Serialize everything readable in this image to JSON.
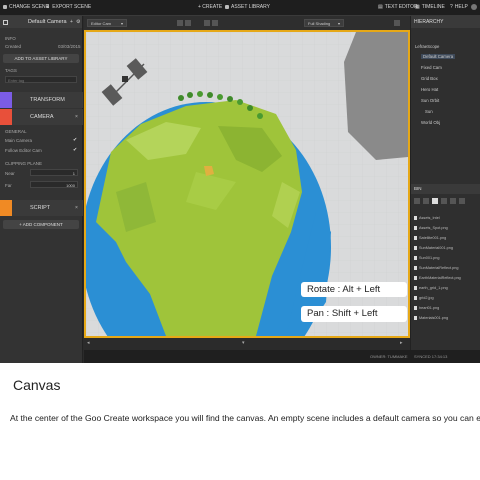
{
  "topbar": {
    "change_scene": "CHANGE SCENE",
    "export_scene": "EXPORT SCENE",
    "create": "+ CREATE",
    "asset_library": "ASSET LIBRARY",
    "text_editor": "TEXT EDITOR",
    "timeline": "TIMELINE",
    "help": "HELP"
  },
  "left_panel": {
    "title": "Default Camera",
    "info_label": "INFO",
    "created_label": "Created",
    "created_date": "03/03/2015",
    "add_to_library": "ADD TO ASSET LIBRARY",
    "tags_label": "TAGS",
    "tags_placeholder": "Enter tag",
    "transform_label": "TRANSFORM",
    "camera_label": "CAMERA",
    "general_label": "GENERAL",
    "main_camera_label": "Main Camera",
    "follow_editor_label": "Follow Editor Cam",
    "clipping_label": "CLIPPING PLANE",
    "near_label": "Near",
    "near_value": "1",
    "far_label": "Far",
    "far_value": "1000",
    "script_label": "SCRIPT",
    "add_component": "+ ADD COMPONENT"
  },
  "viewport_toolbar": {
    "camera_select": "Editor Cam",
    "shading_select": "Full Shading"
  },
  "tooltips": {
    "rotate": "Rotate : Alt + Left",
    "pan": "Pan      : Shift + Left"
  },
  "hierarchy": {
    "title": "HIERARCHY",
    "items": [
      "LefraeScope",
      "Default Camera",
      "Fixed Cam",
      "Grid Box",
      "Hero Hat",
      "Sun Orbit",
      "Sun",
      "World Obj"
    ]
  },
  "assets": {
    "title": "BIN",
    "items": [
      "Assets_Intel",
      "Assets_Spot.png",
      "Satellite001.png",
      "SunMaterial001.png",
      "Sun001.png",
      "SunMaterialReflect.png",
      "EarthMaterialReflect.png",
      "earth_grid_1.png",
      "grid2.jpg",
      "heart01.png",
      "Materials001.png"
    ]
  },
  "status": {
    "left": "OWNER: TUMMAKE",
    "right": "SYNCED 17:34:13"
  },
  "document": {
    "heading": "Canvas",
    "body": "At the center of the Goo Create workspace you will find the canvas. An empty scene includes a default camera so you can eas"
  },
  "colors": {
    "accent": "#e6a817",
    "transform_icon": "#7b5ce6",
    "camera_icon": "#e8503a",
    "script_icon": "#f08a24",
    "earth_land": "#9fc43a",
    "earth_water": "#2b8fd4"
  }
}
